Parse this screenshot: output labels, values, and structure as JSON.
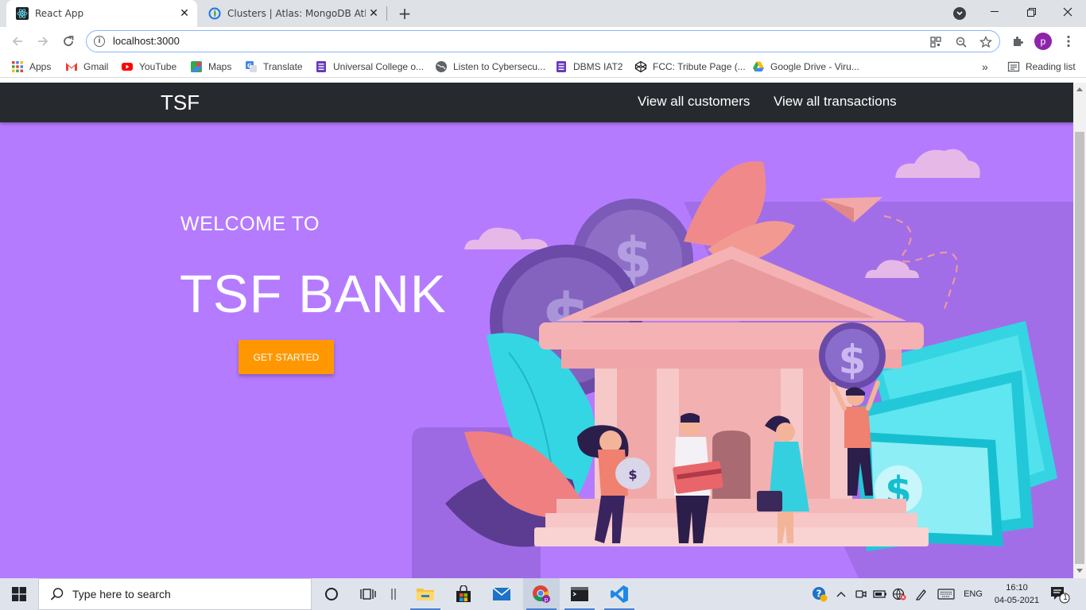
{
  "browser": {
    "tabs": [
      {
        "title": "React App",
        "active": true
      },
      {
        "title": "Clusters | Atlas: MongoDB Atlas",
        "active": false
      }
    ],
    "url": "localhost:3000",
    "profile_initial": "p",
    "bookmarks": [
      {
        "label": "Apps",
        "icon": "apps-grid-icon"
      },
      {
        "label": "Gmail",
        "icon": "gmail-icon"
      },
      {
        "label": "YouTube",
        "icon": "youtube-icon"
      },
      {
        "label": "Maps",
        "icon": "maps-icon"
      },
      {
        "label": "Translate",
        "icon": "translate-icon"
      },
      {
        "label": "Universal College o...",
        "icon": "forms-icon"
      },
      {
        "label": "Listen to Cybersecu...",
        "icon": "globe-icon"
      },
      {
        "label": "DBMS IAT2",
        "icon": "forms-icon"
      },
      {
        "label": "FCC: Tribute Page (...",
        "icon": "codepen-icon"
      },
      {
        "label": "Google Drive - Viru...",
        "icon": "drive-icon"
      }
    ],
    "overflow_label": "»",
    "reading_list": "Reading list"
  },
  "app": {
    "brand": "TSF",
    "nav": {
      "customers": "View all customers",
      "transactions": "View all transactions"
    },
    "hero": {
      "welcome": "WELCOME TO",
      "title": "TSF BANK",
      "cta": "GET STARTED"
    },
    "colors": {
      "background": "#b57bff",
      "navbar": "#262a2f",
      "cta": "#ff9800"
    }
  },
  "taskbar": {
    "search_placeholder": "Type here to search",
    "language": "ENG",
    "time": "16:10",
    "date": "04-05-2021",
    "notification_count": "1"
  }
}
